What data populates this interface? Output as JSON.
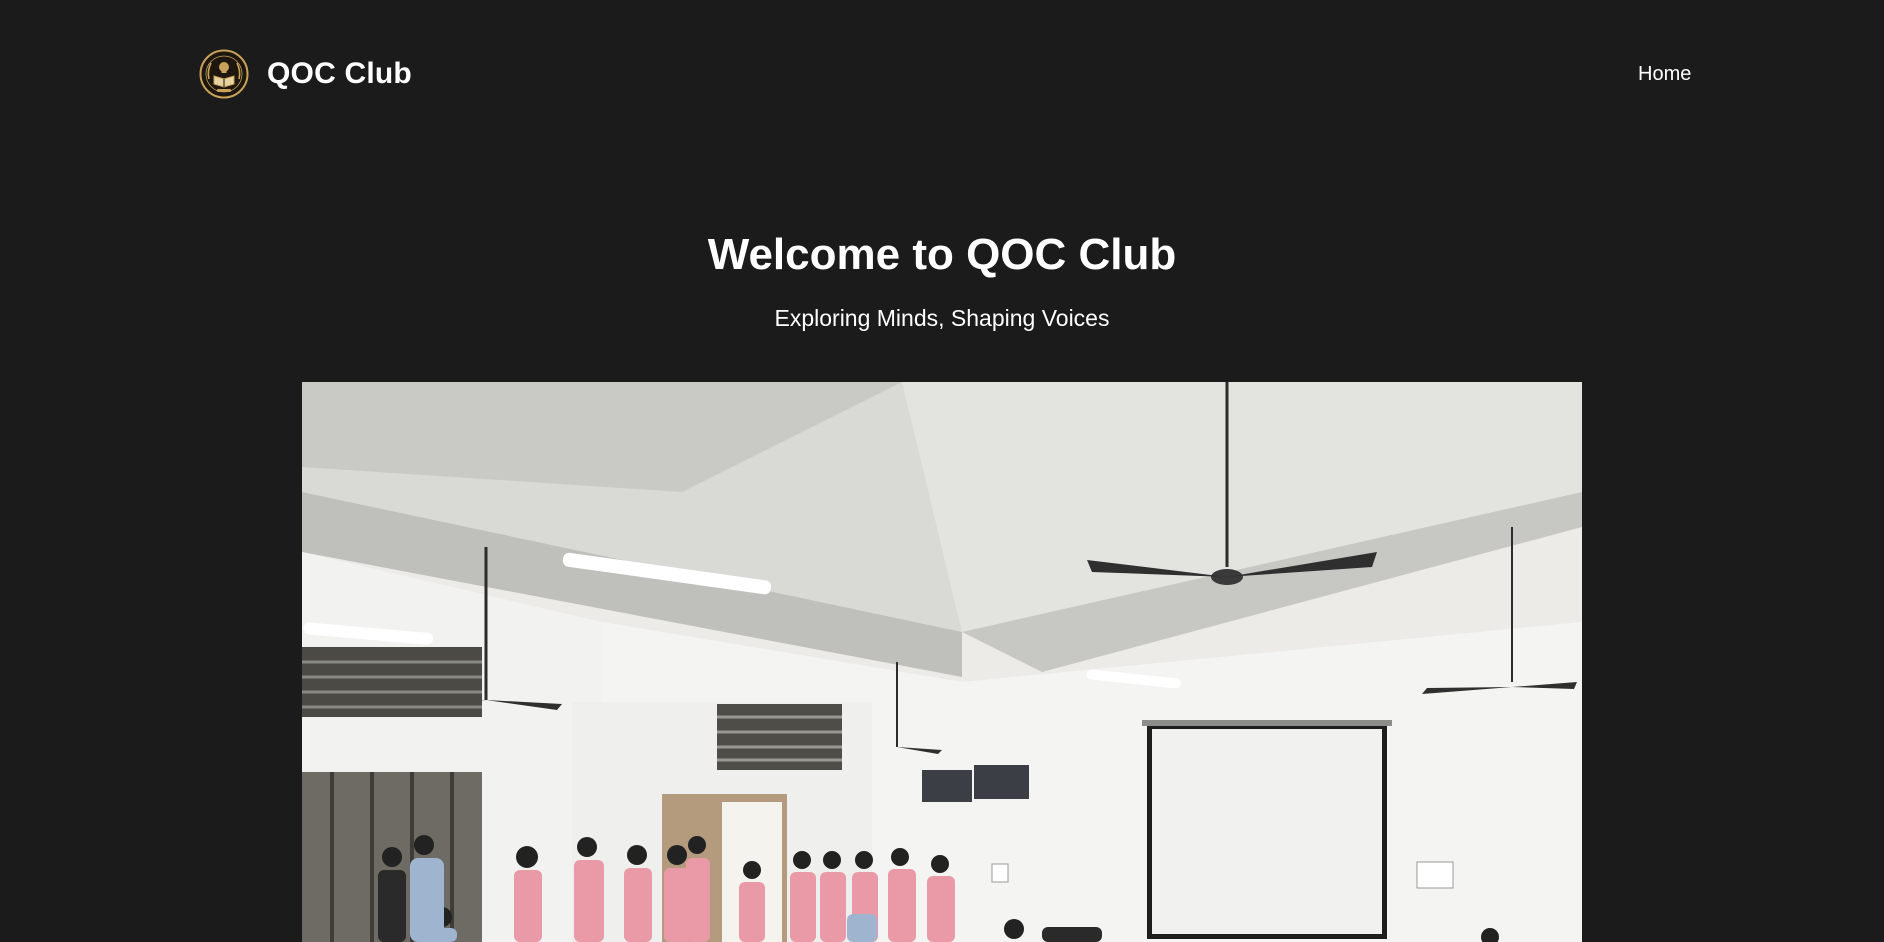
{
  "navbar": {
    "brand_name": "QOC Club",
    "logo_icon": "club-emblem-icon",
    "links": [
      {
        "label": "Home"
      }
    ]
  },
  "hero": {
    "title": "Welcome to QOC Club",
    "subtitle": "Exploring Minds, Shaping Voices"
  },
  "colors": {
    "background": "#1b1b1b",
    "text": "#ffffff",
    "logo_gold": "#c9a25a",
    "shirt_pink": "#e99aa6",
    "shirt_blue": "#9fb4cf"
  }
}
